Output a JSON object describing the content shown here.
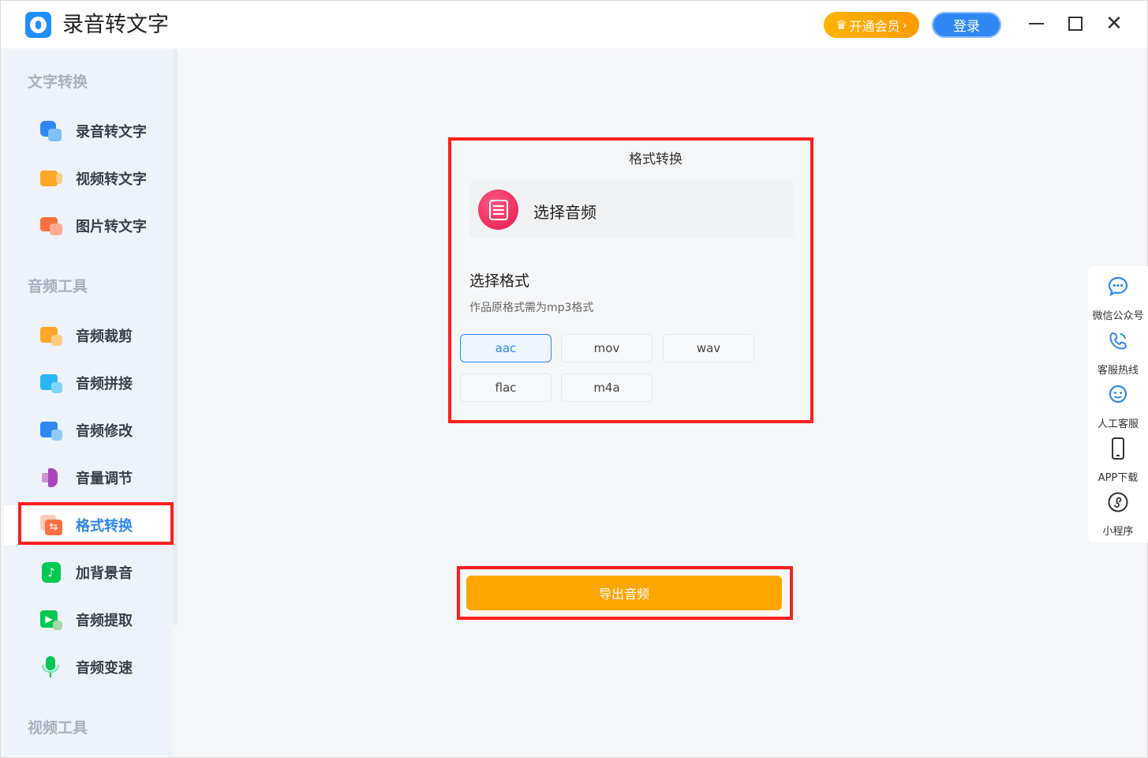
{
  "window": {
    "app_title": "录音转文字",
    "vip_label": "开通会员",
    "login_label": "登录",
    "close_glyph": "✕"
  },
  "sidebar": {
    "sections": [
      {
        "title": "文字转换"
      },
      {
        "title": "音频工具"
      },
      {
        "title": "视频工具"
      }
    ],
    "items": [
      {
        "label": "录音转文字",
        "icon": "mic-text-icon"
      },
      {
        "label": "视频转文字",
        "icon": "video-text-icon"
      },
      {
        "label": "图片转文字",
        "icon": "image-text-icon"
      },
      {
        "label": "音频裁剪",
        "icon": "audio-cut-icon"
      },
      {
        "label": "音频拼接",
        "icon": "audio-merge-icon"
      },
      {
        "label": "音频修改",
        "icon": "audio-edit-icon"
      },
      {
        "label": "音量调节",
        "icon": "volume-icon"
      },
      {
        "label": "格式转换",
        "icon": "format-convert-icon",
        "active": true
      },
      {
        "label": "加背景音",
        "icon": "bg-music-icon"
      },
      {
        "label": "音频提取",
        "icon": "audio-extract-icon"
      },
      {
        "label": "音频变速",
        "icon": "audio-speed-icon"
      }
    ]
  },
  "main": {
    "panel_title": "格式转换",
    "select_audio_label": "选择音频",
    "format_title": "选择格式",
    "format_hint": "作品原格式需为mp3格式",
    "formats": [
      {
        "label": "aac",
        "selected": true
      },
      {
        "label": "mov",
        "selected": false
      },
      {
        "label": "wav",
        "selected": false
      },
      {
        "label": "flac",
        "selected": false
      },
      {
        "label": "m4a",
        "selected": false
      }
    ],
    "export_label": "导出音频"
  },
  "right_bar": {
    "items": [
      {
        "label": "微信公众号",
        "icon": "wechat-icon"
      },
      {
        "label": "客服热线",
        "icon": "phone-icon"
      },
      {
        "label": "人工客服",
        "icon": "service-icon"
      },
      {
        "label": "APP下载",
        "icon": "mobile-icon"
      },
      {
        "label": "小程序",
        "icon": "miniprogram-icon"
      }
    ]
  },
  "colors": {
    "accent": "#2f87f3",
    "export": "#ffa500",
    "vip": "#ffab00",
    "highlight": "#ff1f1f"
  }
}
